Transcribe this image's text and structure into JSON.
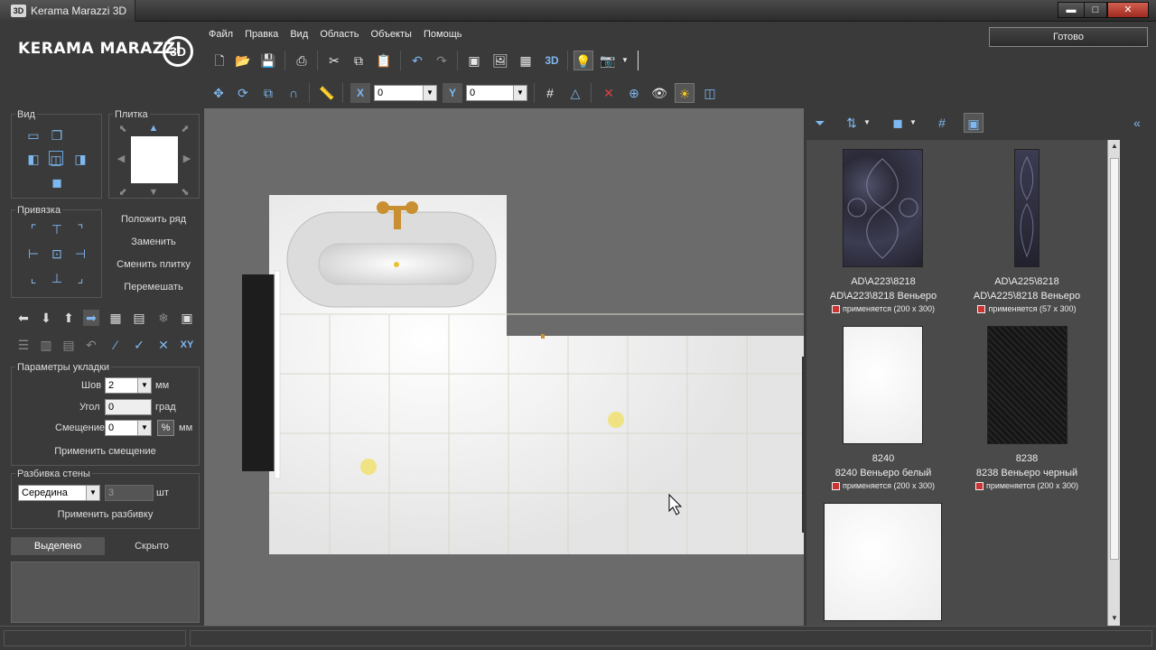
{
  "window": {
    "title": "Kerama Marazzi 3D",
    "badge": "3D",
    "min": "▬",
    "max": "□",
    "close": "✕"
  },
  "logo": {
    "text": "KERAMA MARAZZI",
    "badge": "3D"
  },
  "menu": [
    "Файл",
    "Правка",
    "Вид",
    "Область",
    "Объекты",
    "Помощь"
  ],
  "done_button": "Готово",
  "toolbar2": {
    "x_label": "X",
    "x_value": "0",
    "y_label": "Y",
    "y_value": "0"
  },
  "toolbar1": {
    "label_3d": "3D"
  },
  "left": {
    "view_label": "Вид",
    "tile_label": "Плитка",
    "snap_label": "Привязка",
    "actions": [
      "Положить ряд",
      "Заменить",
      "Сменить плитку",
      "Перемешать"
    ],
    "xy_label": "XY",
    "layout_params": {
      "title": "Параметры укладки",
      "seam_label": "Шов",
      "seam_value": "2",
      "seam_unit": "мм",
      "angle_label": "Угол",
      "angle_value": "0",
      "angle_unit": "град",
      "offset_label": "Смещение",
      "offset_value": "0",
      "offset_percent": "%",
      "offset_unit": "мм",
      "apply_offset": "Применить смещение"
    },
    "wall_split": {
      "title": "Разбивка стены",
      "mode_value": "Середина",
      "count_value": "3",
      "count_unit": "шт",
      "apply": "Применить разбивку"
    },
    "tabs": [
      "Выделено",
      "Скрыто"
    ]
  },
  "catalog": {
    "tiles": [
      {
        "code": "AD\\A223\\8218",
        "name": "AD\\A223\\8218 Веньеро",
        "usage": "применяется (200 x 300)"
      },
      {
        "code": "AD\\A225\\8218",
        "name": "AD\\A225\\8218 Веньеро",
        "usage": "применяется (57 x 300)"
      },
      {
        "code": "8240",
        "name": "8240 Веньеро белый",
        "usage": "применяется (200 x 300)"
      },
      {
        "code": "8238",
        "name": "8238 Веньеро черный",
        "usage": "применяется (200 x 300)"
      }
    ]
  },
  "colors": {
    "accent": "#7fb8f0",
    "tile_dark": "#2a2a38",
    "tile_black": "#151515"
  }
}
